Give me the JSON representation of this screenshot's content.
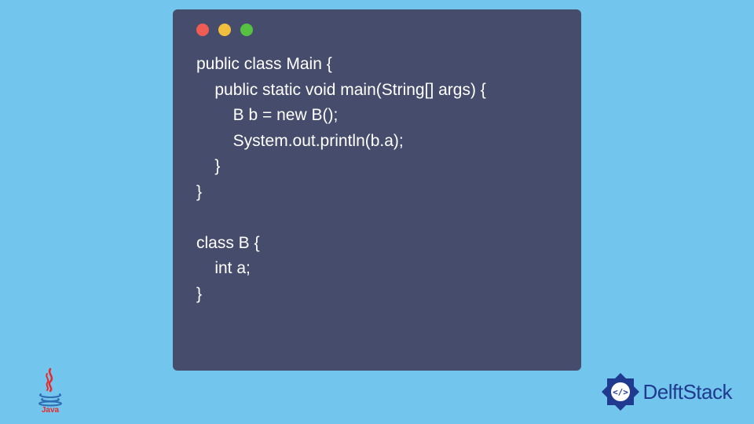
{
  "window": {
    "dots": [
      "red",
      "yellow",
      "green"
    ]
  },
  "code": "public class Main {\n    public static void main(String[] args) {\n        B b = new B();\n        System.out.println(b.a);\n    }\n}\n\nclass B {\n    int a;\n}",
  "logos": {
    "java_label": "Java",
    "delft_label": "DelftStack"
  },
  "colors": {
    "page_bg": "#72c6ed",
    "window_bg": "#464d6c",
    "code_fg": "#ffffff",
    "dot_red": "#ee5c54",
    "dot_yellow": "#f2be3d",
    "dot_green": "#57c242",
    "delft_blue": "#1f3a8f"
  }
}
